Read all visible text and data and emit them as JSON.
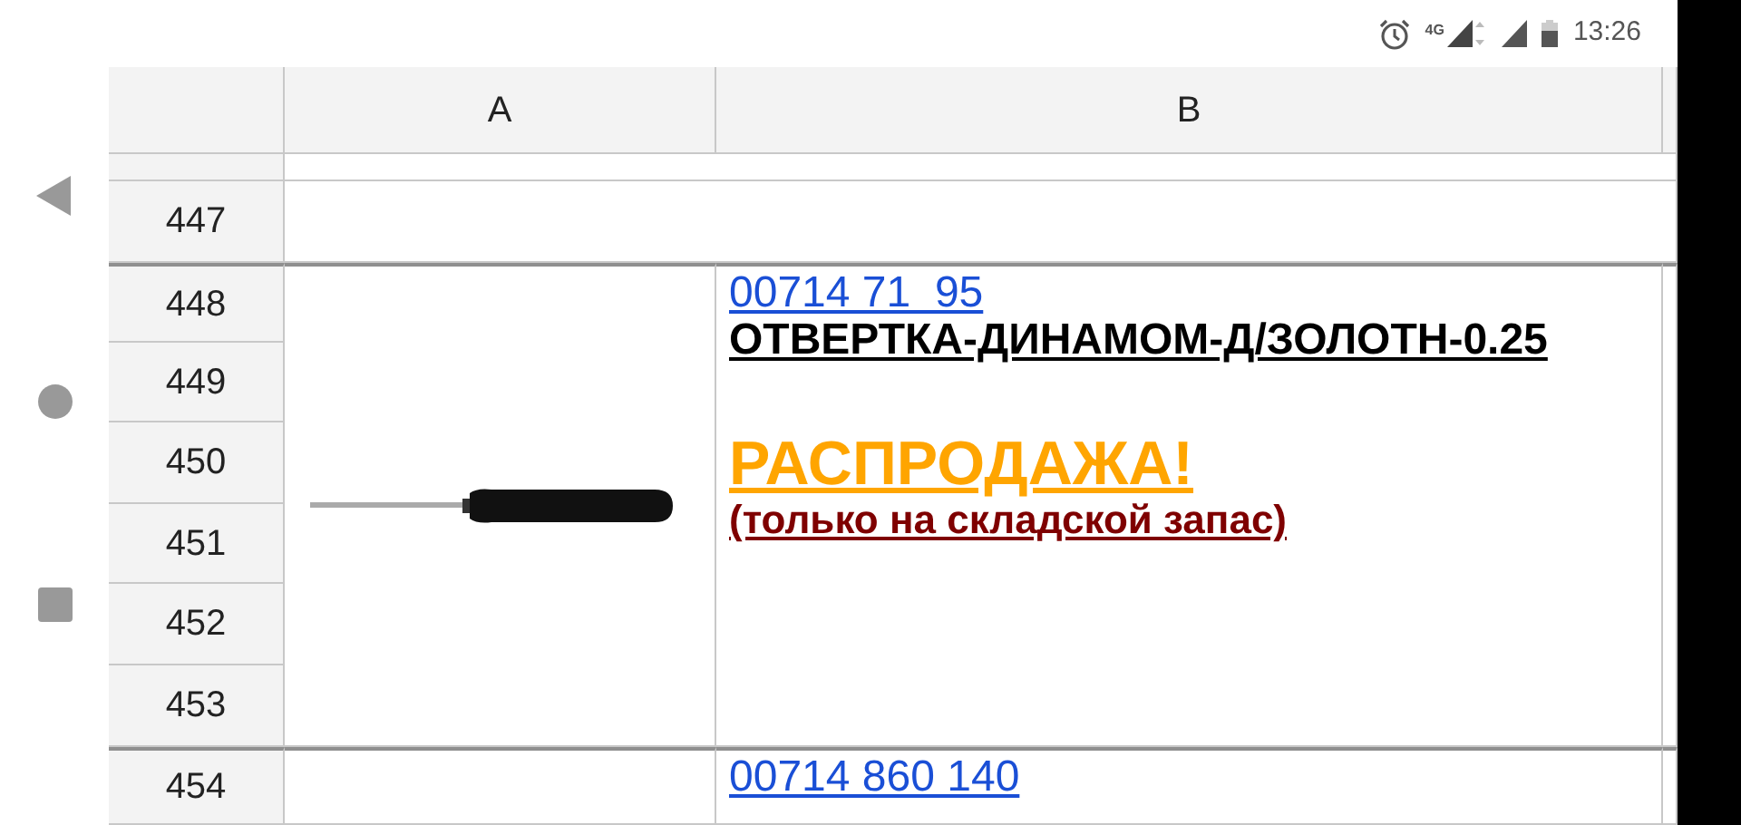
{
  "status_bar": {
    "time": "13:26",
    "network": "4G"
  },
  "columns": [
    "A",
    "B"
  ],
  "rows": [
    "447",
    "448",
    "449",
    "450",
    "451",
    "452",
    "453",
    "454"
  ],
  "entries": [
    {
      "code": "00714 71  95",
      "picture": true,
      "lines": [
        {
          "kind": "title",
          "text": "ОТВЕРТКА-ДИНАМОМ-Д/ЗОЛОТН-0.25"
        },
        {
          "kind": "sale",
          "text": "РАСПРОДАЖА!"
        },
        {
          "kind": "note",
          "text": "(только на складской запас)"
        }
      ]
    },
    {
      "code": "00714 860 140"
    }
  ]
}
